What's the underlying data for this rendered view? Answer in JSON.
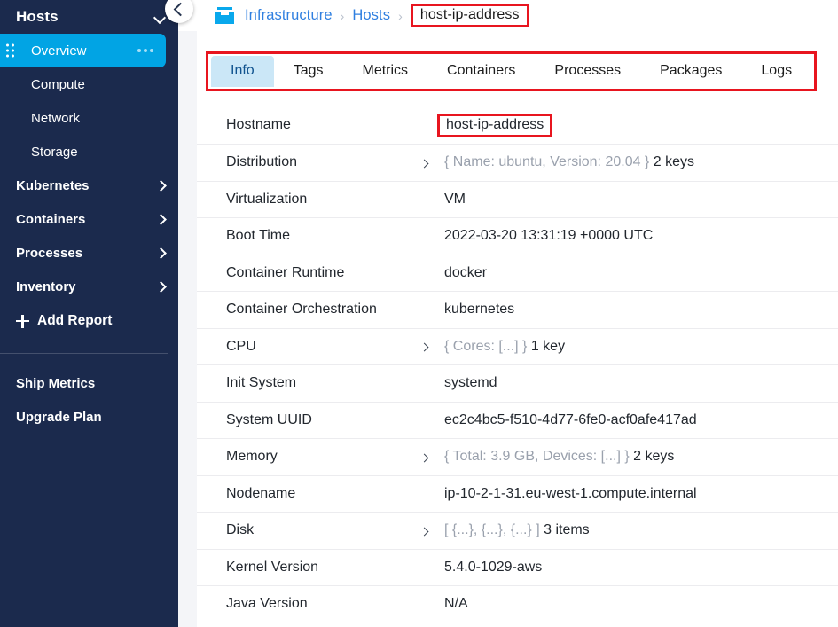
{
  "sidebar": {
    "title": "Hosts",
    "collapse_icon": "chevron-down-icon",
    "items": [
      {
        "label": "Overview",
        "active": true,
        "kind": "sub",
        "handle": "drag-handle-icon",
        "menu": "kebab-menu-icon"
      },
      {
        "label": "Compute",
        "active": false,
        "kind": "sub"
      },
      {
        "label": "Network",
        "active": false,
        "kind": "sub"
      },
      {
        "label": "Storage",
        "active": false,
        "kind": "sub"
      },
      {
        "label": "Kubernetes",
        "active": false,
        "kind": "top",
        "chevron": "chevron-right-icon"
      },
      {
        "label": "Containers",
        "active": false,
        "kind": "top",
        "chevron": "chevron-right-icon"
      },
      {
        "label": "Processes",
        "active": false,
        "kind": "top",
        "chevron": "chevron-right-icon"
      },
      {
        "label": "Inventory",
        "active": false,
        "kind": "top",
        "chevron": "chevron-right-icon"
      }
    ],
    "add_report": "Add Report",
    "add_report_icon": "plus-icon",
    "footer_items": [
      {
        "label": "Ship Metrics"
      },
      {
        "label": "Upgrade Plan"
      }
    ]
  },
  "collapse_button": {
    "icon": "chevron-left-icon"
  },
  "breadcrumb": {
    "icon": "infrastructure-box-icon",
    "items": [
      {
        "label": "Infrastructure",
        "link": true,
        "highlighted": false
      },
      {
        "label": "Hosts",
        "link": true,
        "highlighted": false
      },
      {
        "label": "host-ip-address",
        "link": false,
        "highlighted": true
      }
    ],
    "separator": "›"
  },
  "tabs": {
    "highlighted": true,
    "items": [
      {
        "label": "Info",
        "active": true
      },
      {
        "label": "Tags",
        "active": false
      },
      {
        "label": "Metrics",
        "active": false
      },
      {
        "label": "Containers",
        "active": false
      },
      {
        "label": "Processes",
        "active": false
      },
      {
        "label": "Packages",
        "active": false
      },
      {
        "label": "Logs",
        "active": false
      }
    ]
  },
  "info": {
    "rows": [
      {
        "label": "Hostname",
        "value": "host-ip-address",
        "expandable": false,
        "highlighted": true
      },
      {
        "label": "Distribution",
        "value": "{ Name: ubuntu, Version: 20.04 }",
        "suffix": "2 keys",
        "expandable": true
      },
      {
        "label": "Virtualization",
        "value": "VM",
        "expandable": false
      },
      {
        "label": "Boot Time",
        "value": "2022-03-20 13:31:19 +0000 UTC",
        "expandable": false
      },
      {
        "label": "Container Runtime",
        "value": "docker",
        "expandable": false
      },
      {
        "label": "Container Orchestration",
        "value": "kubernetes",
        "expandable": false
      },
      {
        "label": "CPU",
        "value": "{ Cores: [...] }",
        "suffix": "1 key",
        "expandable": true
      },
      {
        "label": "Init System",
        "value": "systemd",
        "expandable": false
      },
      {
        "label": "System UUID",
        "value": "ec2c4bc5-f510-4d77-6fe0-acf0afe417ad",
        "expandable": false
      },
      {
        "label": "Memory",
        "value": "{ Total: 3.9 GB, Devices: [...] }",
        "suffix": "2 keys",
        "expandable": true
      },
      {
        "label": "Nodename",
        "value": "ip-10-2-1-31.eu-west-1.compute.internal",
        "expandable": false
      },
      {
        "label": "Disk",
        "value": "[ {...}, {...}, {...} ]",
        "suffix": "3 items",
        "expandable": true
      },
      {
        "label": "Kernel Version",
        "value": "5.4.0-1029-aws",
        "expandable": false
      },
      {
        "label": "Java Version",
        "value": "N/A",
        "expandable": false
      }
    ]
  },
  "colors": {
    "sidebar_bg": "#1b2a4d",
    "accent_blue": "#01a4e4",
    "link_blue": "#2f7fe0",
    "tab_active_bg": "#cbe7f7",
    "tab_active_text": "#10538f",
    "highlight_red": "#e8151f",
    "page_bg": "#f4f5f8"
  }
}
